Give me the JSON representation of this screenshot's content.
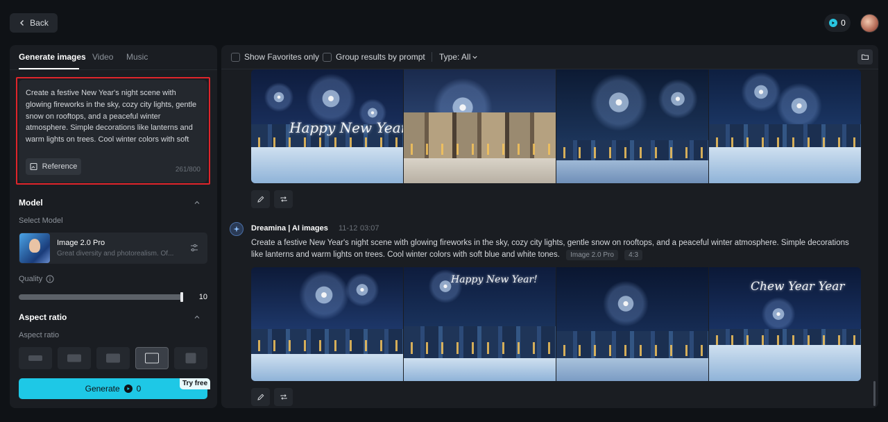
{
  "topbar": {
    "back_label": "Back",
    "credits_value": "0"
  },
  "left": {
    "tabs": [
      {
        "label": "Generate images",
        "active": true
      },
      {
        "label": "Video",
        "active": false
      },
      {
        "label": "Music",
        "active": false
      }
    ],
    "prompt": {
      "text": "Create a festive New Year's night scene with glowing fireworks in the sky, cozy city lights, gentle snow on rooftops, and a peaceful winter atmosphere. Simple decorations like lanterns and warm lights on trees. Cool winter colors with soft blue and white tones.",
      "reference_label": "Reference",
      "counter": "261/800"
    },
    "model": {
      "section_title": "Model",
      "select_label": "Select Model",
      "name": "Image 2.0 Pro",
      "description": "Great diversity and photorealism. Of..."
    },
    "quality": {
      "label": "Quality",
      "value": "10",
      "level_fraction": 1.0
    },
    "aspect": {
      "section_title": "Aspect ratio",
      "label": "Aspect ratio",
      "options": [
        "21:9",
        "16:9",
        "3:2",
        "4:3",
        "1:1"
      ],
      "selected_index": 3
    },
    "generate": {
      "label": "Generate",
      "cost": "0",
      "badge": "Try free"
    }
  },
  "right": {
    "filters": {
      "favorites_label": "Show Favorites only",
      "group_label": "Group results by prompt",
      "type_label": "Type: All"
    },
    "generation": {
      "author": "Dreamina | AI images",
      "date": "11-12",
      "time": "03:07",
      "prompt": "Create a festive New Year's night scene with glowing fireworks in the sky, cozy city lights, gentle snow on rooftops, and a peaceful winter atmosphere. Simple decorations like lanterns and warm lights on trees. Cool winter colors with soft blue and white tones.",
      "model_tag": "Image 2.0 Pro",
      "ratio_tag": "4:3"
    },
    "image_texts": {
      "row1_img1": "Happy New Year",
      "row2_img2": "Happy New Year!",
      "row2_img4": "Chew Year Year"
    }
  },
  "colors": {
    "accent": "#1ec8e6",
    "highlight_border": "#e0252b",
    "panel_bg": "#1a1d22",
    "page_bg": "#0f1216"
  }
}
